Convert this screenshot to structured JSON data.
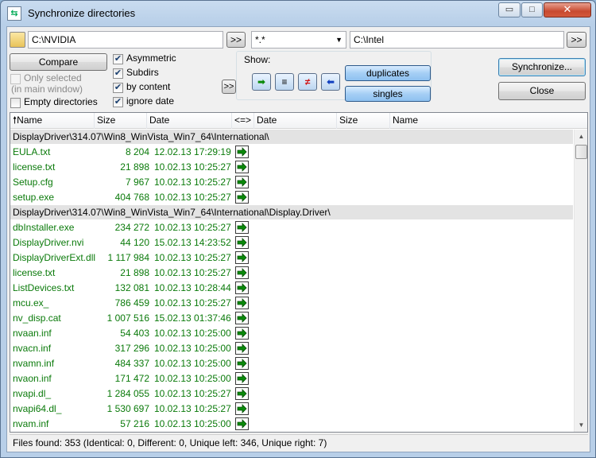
{
  "window": {
    "title": "Synchronize directories"
  },
  "titlebar": {
    "minimize": "▭",
    "maximize": "□",
    "close": "✕"
  },
  "paths": {
    "left": "C:\\NVIDIA",
    "mask": "*.*",
    "right": "C:\\Intel",
    "browse_left_label": ">>",
    "browse_right_label": ">>"
  },
  "options": {
    "compare_label": "Compare",
    "only_selected_label": "Only selected",
    "only_selected_sub": "(in main window)",
    "empty_dirs_label": "Empty directories",
    "asymmetric_label": "Asymmetric",
    "subdirs_label": "Subdirs",
    "by_content_label": "by content",
    "ignore_date_label": "ignore date",
    "more_label": ">>",
    "asymmetric_checked": true,
    "subdirs_checked": true,
    "by_content_checked": true,
    "ignore_date_checked": true,
    "only_selected_checked": false,
    "empty_dirs_checked": false
  },
  "show": {
    "label": "Show:",
    "duplicates_label": "duplicates",
    "singles_label": "singles",
    "filters": [
      {
        "name": "left-to-right-filter",
        "glyph": "➡",
        "color": "#0a8a0a"
      },
      {
        "name": "equal-filter",
        "glyph": "≡",
        "color": "#000000"
      },
      {
        "name": "unequal-filter",
        "glyph": "≠",
        "color": "#d01010"
      },
      {
        "name": "right-to-left-filter",
        "glyph": "⬅",
        "color": "#1040c0"
      }
    ]
  },
  "actions": {
    "synchronize_label": "Synchronize...",
    "close_label": "Close"
  },
  "columns": {
    "name": "Name",
    "size": "Size",
    "date": "Date",
    "compare": "<=>",
    "date2": "Date",
    "size2": "Size",
    "name2": "Name"
  },
  "rows": [
    {
      "type": "dir",
      "text": "DisplayDriver\\314.07\\Win8_WinVista_Win7_64\\International\\"
    },
    {
      "type": "file",
      "name": "EULA.txt",
      "size": "8 204",
      "date": "12.02.13 17:29:19"
    },
    {
      "type": "file",
      "name": "license.txt",
      "size": "21 898",
      "date": "10.02.13 10:25:27"
    },
    {
      "type": "file",
      "name": "Setup.cfg",
      "size": "7 967",
      "date": "10.02.13 10:25:27"
    },
    {
      "type": "file",
      "name": "setup.exe",
      "size": "404 768",
      "date": "10.02.13 10:25:27"
    },
    {
      "type": "dir",
      "text": "DisplayDriver\\314.07\\Win8_WinVista_Win7_64\\International\\Display.Driver\\"
    },
    {
      "type": "file",
      "name": "dbInstaller.exe",
      "size": "234 272",
      "date": "10.02.13 10:25:27"
    },
    {
      "type": "file",
      "name": "DisplayDriver.nvi",
      "size": "44 120",
      "date": "15.02.13 14:23:52"
    },
    {
      "type": "file",
      "name": "DisplayDriverExt.dll",
      "size": "1 117 984",
      "date": "10.02.13 10:25:27"
    },
    {
      "type": "file",
      "name": "license.txt",
      "size": "21 898",
      "date": "10.02.13 10:25:27"
    },
    {
      "type": "file",
      "name": "ListDevices.txt",
      "size": "132 081",
      "date": "10.02.13 10:28:44"
    },
    {
      "type": "file",
      "name": "mcu.ex_",
      "size": "786 459",
      "date": "10.02.13 10:25:27"
    },
    {
      "type": "file",
      "name": "nv_disp.cat",
      "size": "1 007 516",
      "date": "15.02.13 01:37:46"
    },
    {
      "type": "file",
      "name": "nvaan.inf",
      "size": "54 403",
      "date": "10.02.13 10:25:00"
    },
    {
      "type": "file",
      "name": "nvacn.inf",
      "size": "317 296",
      "date": "10.02.13 10:25:00"
    },
    {
      "type": "file",
      "name": "nvamn.inf",
      "size": "484 337",
      "date": "10.02.13 10:25:00"
    },
    {
      "type": "file",
      "name": "nvaon.inf",
      "size": "171 472",
      "date": "10.02.13 10:25:00"
    },
    {
      "type": "file",
      "name": "nvapi.dl_",
      "size": "1 284 055",
      "date": "10.02.13 10:25:27"
    },
    {
      "type": "file",
      "name": "nvapi64.dl_",
      "size": "1 530 697",
      "date": "10.02.13 10:25:27"
    },
    {
      "type": "file",
      "name": "nvam.inf",
      "size": "57 216",
      "date": "10.02.13 10:25:00"
    }
  ],
  "status": {
    "text": "Files found: 353  (Identical: 0, Different: 0, Unique left: 346, Unique right: 7)"
  }
}
